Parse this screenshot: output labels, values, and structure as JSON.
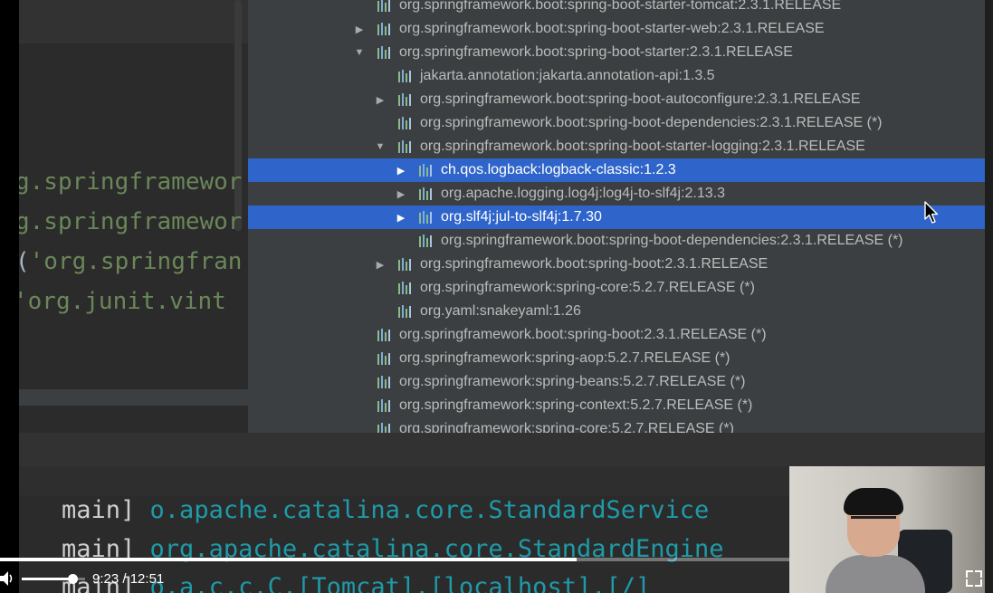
{
  "editor": {
    "code_lines": [
      {
        "prefix": "",
        "text": "g.springframewor"
      },
      {
        "prefix": "",
        "text": "g.springframewor"
      },
      {
        "prefix": "(",
        "text": "'org.springfran"
      },
      {
        "prefix": " ",
        "text": "'org.junit.vint"
      }
    ]
  },
  "dependency_tree": {
    "rows": [
      {
        "label": "org.springframework.boot:spring-boot-starter-tomcat:2.3.1.RELEASE",
        "arrow": "",
        "selected": false
      },
      {
        "label": "org.springframework.boot:spring-boot-starter-web:2.3.1.RELEASE",
        "arrow": "▶",
        "selected": false
      },
      {
        "label": "org.springframework.boot:spring-boot-starter:2.3.1.RELEASE",
        "arrow": "▼",
        "selected": false
      },
      {
        "label": "jakarta.annotation:jakarta.annotation-api:1.3.5",
        "arrow": "",
        "selected": false
      },
      {
        "label": "org.springframework.boot:spring-boot-autoconfigure:2.3.1.RELEASE",
        "arrow": "▶",
        "selected": false
      },
      {
        "label": "org.springframework.boot:spring-boot-dependencies:2.3.1.RELEASE (*)",
        "arrow": "",
        "selected": false
      },
      {
        "label": "org.springframework.boot:spring-boot-starter-logging:2.3.1.RELEASE",
        "arrow": "▼",
        "selected": false
      },
      {
        "label": "ch.qos.logback:logback-classic:1.2.3",
        "arrow": "▶",
        "selected": true
      },
      {
        "label": "org.apache.logging.log4j:log4j-to-slf4j:2.13.3",
        "arrow": "▶",
        "selected": false
      },
      {
        "label": "org.slf4j:jul-to-slf4j:1.7.30",
        "arrow": "▶",
        "selected": true
      },
      {
        "label": "org.springframework.boot:spring-boot-dependencies:2.3.1.RELEASE (*)",
        "arrow": "",
        "selected": false
      },
      {
        "label": "org.springframework.boot:spring-boot:2.3.1.RELEASE",
        "arrow": "▶",
        "selected": false
      },
      {
        "label": "org.springframework:spring-core:5.2.7.RELEASE (*)",
        "arrow": "",
        "selected": false
      },
      {
        "label": "org.yaml:snakeyaml:1.26",
        "arrow": "",
        "selected": false
      },
      {
        "label": "org.springframework.boot:spring-boot:2.3.1.RELEASE (*)",
        "arrow": "",
        "selected": false
      },
      {
        "label": "org.springframework:spring-aop:5.2.7.RELEASE (*)",
        "arrow": "",
        "selected": false
      },
      {
        "label": "org.springframework:spring-beans:5.2.7.RELEASE (*)",
        "arrow": "",
        "selected": false
      },
      {
        "label": "org.springframework:spring-context:5.2.7.RELEASE (*)",
        "arrow": "",
        "selected": false
      },
      {
        "label": "org.springframework:spring-core:5.2.7.RELEASE (*)",
        "arrow": "",
        "selected": false
      }
    ]
  },
  "console": {
    "lines": [
      {
        "thread": "main]",
        "logger": "o.apache.catalina.core.StandardService"
      },
      {
        "thread": "main]",
        "logger": "org.apache.catalina.core.StandardEngine"
      },
      {
        "thread": "main]",
        "logger": "o.a.c.c.C.[Tomcat].[localhost].[/]"
      }
    ]
  },
  "player": {
    "current_time": "9:23",
    "separator": "/",
    "duration": "12:51",
    "progress_fraction": 0.73,
    "volume_fraction": 0.8,
    "volume_icon": "speaker-icon",
    "fullscreen_icon": "fullscreen-icon"
  },
  "colors": {
    "selection": "#2f65ca",
    "tree_background": "#3c3f41",
    "string_green": "#6a8759",
    "logger_teal": "#1f9aa8"
  }
}
